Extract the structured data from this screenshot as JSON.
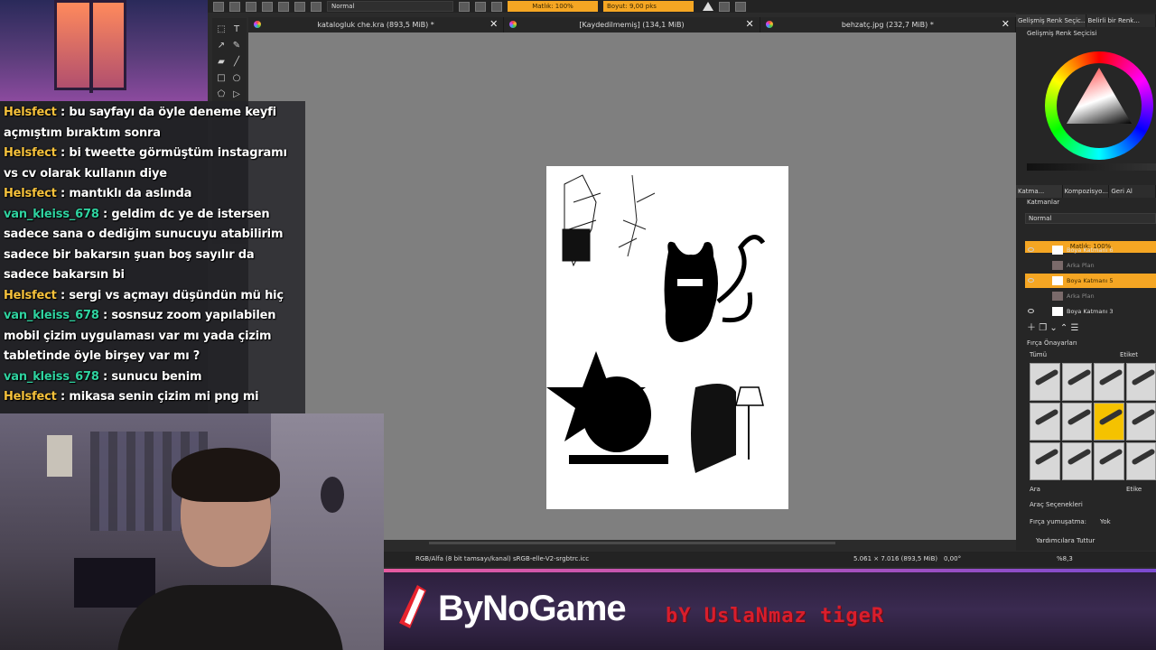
{
  "toolbar": {
    "blend_mode": "Normal",
    "opacity": "Matlık: 100%",
    "size": "Boyut: 9,00 pks"
  },
  "tabs": [
    {
      "label": "katalogluk che.kra (893,5 MiB) *"
    },
    {
      "label": "[Kaydedilmemiş]  (134,1 MiB)"
    },
    {
      "label": "behzatç.jpg (232,7 MiB) *"
    }
  ],
  "statusbar": {
    "color_profile": "RGB/Alfa (8 bit tamsayı/kanal)  sRGB-elle-V2-srgbtrc.icc",
    "dimensions": "5.061 × 7.016 (893,5 MiB)",
    "rotation": "0,00°",
    "zoom": "%8,3"
  },
  "docker": {
    "color_tabs": [
      "Gelişmiş Renk Seçic...",
      "Belirli bir Renk..."
    ],
    "color_title": "Gelişmiş Renk Seçicisi",
    "layer_tabs": [
      "Katma...",
      "Kompozisyo...",
      "Geri Al"
    ],
    "layers_title": "Katmanlar",
    "layer_blend": "Normal",
    "layer_opacity": "Matlık: 100%",
    "layers": [
      {
        "name": "Boya Katmanı 6",
        "active": false,
        "sub": false
      },
      {
        "name": "Arka Plan",
        "active": false,
        "sub": true
      },
      {
        "name": "Boya Katmanı 5",
        "active": true,
        "sub": false
      },
      {
        "name": "Arka Plan",
        "active": false,
        "sub": true
      },
      {
        "name": "Boya Katmanı 3",
        "active": false,
        "sub": false
      }
    ],
    "brush_presets_title": "Fırça Önayarları",
    "brush_filter": "Tümü",
    "brush_tag": "Etiket",
    "search_label": "Ara",
    "tag_checkbox": "Etike",
    "tool_options_title": "Araç Seçenekleri",
    "brush_smoothing_label": "Fırça yumuşatma:",
    "brush_smoothing_value": "Yok",
    "assistants_label": "Yardımcılara Tuttur"
  },
  "chat": [
    {
      "user": "Helsfect",
      "color": "#f5c13b",
      "text": "bu sayfayı da öyle deneme keyfi açmıştım bıraktım sonra"
    },
    {
      "user": "Helsfect",
      "color": "#f5c13b",
      "text": "bi tweette görmüştüm instagramı vs cv olarak kullanın diye"
    },
    {
      "user": "Helsfect",
      "color": "#f5c13b",
      "text": "mantıklı da aslında"
    },
    {
      "user": "van_kleiss_678",
      "color": "#2fd3a0",
      "text": "geldim dc ye de istersen sadece sana o dediğim sunucuyu atabilirim sadece bir bakarsın şuan boş sayılır da sadece bakarsın bi"
    },
    {
      "user": "Helsfect",
      "color": "#f5c13b",
      "text": "sergi vs açmayı düşündün mü hiç"
    },
    {
      "user": "van_kleiss_678",
      "color": "#2fd3a0",
      "text": "sosnsuz zoom yapılabilen mobil çizim uygulaması var mı yada çizim tabletinde öyle birşey var mı ?"
    },
    {
      "user": "van_kleiss_678",
      "color": "#2fd3a0",
      "text": "sunucu benim"
    },
    {
      "user": "Helsfect",
      "color": "#f5c13b",
      "text": "mikasa senin çizim mi png mi"
    }
  ],
  "banner": {
    "brand": "ByNoGame",
    "tagline": "bY UslaNmaz tigeR"
  }
}
